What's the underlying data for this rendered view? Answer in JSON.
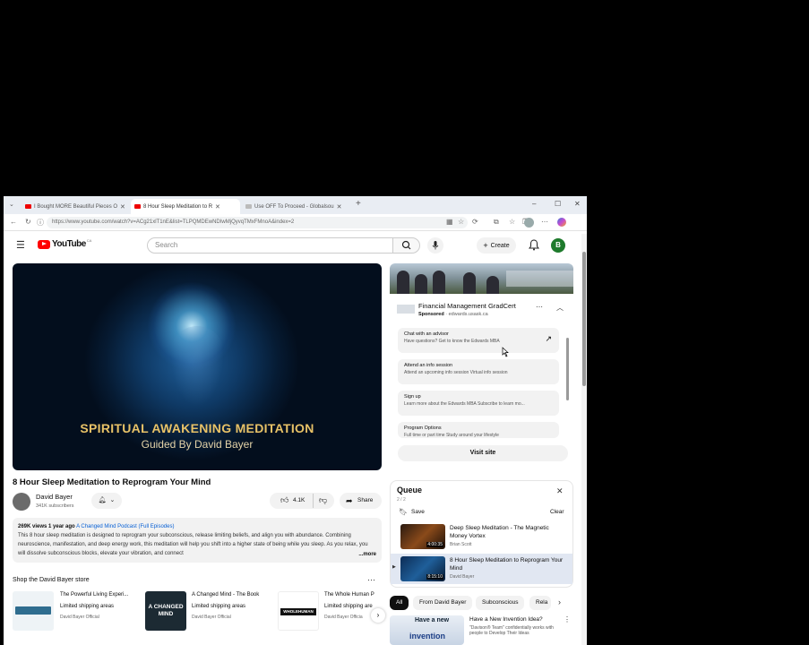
{
  "browser": {
    "tabs": [
      {
        "label": "I Bought MORE Beautiful Pieces O"
      },
      {
        "label": "8 Hour Sleep Meditation to R"
      },
      {
        "label": "Use OFF To Proceed - Globalsou"
      }
    ],
    "url": "https://www.youtube.com/watch?v=ACg21xlT1nE&list=TLPQMDEwNDIwMjQyvqTMxFMnoA&index=2"
  },
  "header": {
    "logo_text": "YouTube",
    "country_code": "CA",
    "search_placeholder": "Search",
    "create_label": "Create",
    "avatar_letter": "B"
  },
  "player": {
    "overlay_title": "SPIRITUAL AWAKENING MEDITATION",
    "overlay_subtitle": "Guided By David Bayer"
  },
  "video": {
    "title": "8 Hour Sleep Meditation to Reprogram Your Mind",
    "channel": "David Bayer",
    "subscribers": "341K subscribers",
    "likes": "4.1K",
    "share_label": "Share"
  },
  "description": {
    "meta": "269K views  1 year ago",
    "podcast": "A Changed Mind Podcast (Full Episodes)",
    "text": "This 8 hour sleep meditation is designed to reprogram your subconscious, release limiting beliefs, and align you with abundance. Combining neuroscience, manifestation, and deep energy work, this meditation will help you shift into a higher state of being while you sleep. As you relax, you will dissolve subconscious blocks, elevate your vibration, and connect",
    "more_label": "...more"
  },
  "shop": {
    "heading": "Shop the David Bayer store",
    "products": [
      {
        "title": "The Powerful Living Experi...",
        "shipping": "Limited shipping areas",
        "store": "David Bayer Official"
      },
      {
        "title": "A Changed Mind - The Book",
        "shipping": "Limited shipping areas",
        "store": "David Bayer Official"
      },
      {
        "title": "The Whole Human P",
        "shipping": "Limited shipping are",
        "store": "David Bayer Officia"
      }
    ],
    "book_cover_text": "A CHANGED MIND",
    "whole_human_text": "WHOLEHUMAN"
  },
  "ad": {
    "title": "Financial Management GradCert",
    "sponsored": "Sponsored",
    "domain": "edwards.usask.ca",
    "options": [
      {
        "title": "Chat with an advisor",
        "subtitle": "Have questions? Get to know the Edwards MBA"
      },
      {
        "title": "Attend an info session",
        "subtitle": "Attend an upcoming info session Virtual info session"
      },
      {
        "title": "Sign up",
        "subtitle": "Learn more about the Edwards MBA Subscribe to learn mo..."
      },
      {
        "title": "Program Options",
        "subtitle": "Full time or part time Study around your lifestyle"
      }
    ],
    "visit_label": "Visit site"
  },
  "queue": {
    "title": "Queue",
    "count": "2 / 2",
    "save_label": "Save",
    "clear_label": "Clear",
    "items": [
      {
        "title": "Deep Sleep Meditation - The Magnetic Money Vortex",
        "author": "Brian Scott",
        "duration": "4:00:35"
      },
      {
        "title": "8 Hour Sleep Meditation to Reprogram Your Mind",
        "author": "David Bayer",
        "duration": "8:15:10"
      }
    ]
  },
  "chips": [
    "All",
    "From David Bayer",
    "Subconscious",
    "Rela"
  ],
  "recommendation": {
    "thumb_line1": "Have a new",
    "thumb_line2": "invention",
    "title": "Have a New Invention Idea?",
    "subtitle": "\"Davison® Team\" confidentially works with people to Develop Their Ideas"
  },
  "colors": {
    "accent_red": "#ff0000",
    "avatar_green": "#1e7a2c",
    "link_blue": "#065fd4"
  }
}
